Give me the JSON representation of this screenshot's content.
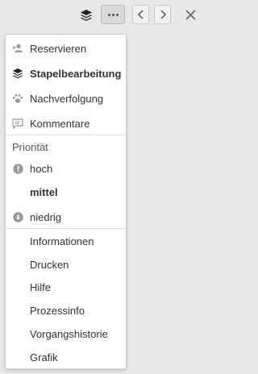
{
  "toolbar": {
    "layers_icon": "layers-icon",
    "more_icon": "more-horizontal-icon",
    "prev_icon": "chevron-left-icon",
    "next_icon": "chevron-right-icon",
    "close_icon": "close-icon"
  },
  "menu": {
    "actions": [
      {
        "label": "Reservieren",
        "icon": "person-add-icon"
      },
      {
        "label": "Stapelbearbeitung",
        "icon": "layers-icon",
        "bold": true
      },
      {
        "label": "Nachverfolgung",
        "icon": "paw-icon"
      },
      {
        "label": "Kommentare",
        "icon": "comment-icon"
      }
    ],
    "priority": {
      "heading": "Priorität",
      "options": [
        {
          "label": "hoch",
          "icon": "exclamation-circle-icon"
        },
        {
          "label": "mittel",
          "selected": true
        },
        {
          "label": "niedrig",
          "icon": "arrow-down-circle-icon"
        }
      ]
    },
    "more": [
      {
        "label": "Informationen"
      },
      {
        "label": "Drucken"
      },
      {
        "label": "Hilfe"
      },
      {
        "label": "Prozessinfo"
      },
      {
        "label": "Vorgangshistorie"
      },
      {
        "label": "Grafik"
      }
    ]
  }
}
